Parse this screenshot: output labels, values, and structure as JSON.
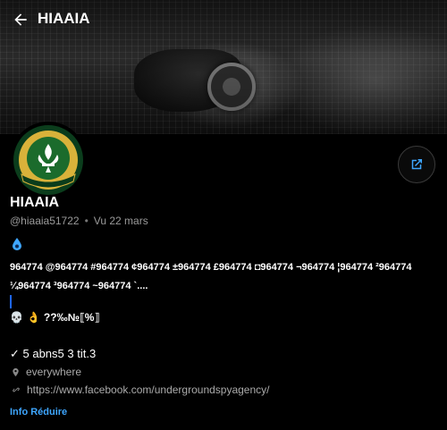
{
  "header": {
    "title": "HIAAIA",
    "back_icon": "arrow-left-icon"
  },
  "banner": {
    "description_icon": "banner-image"
  },
  "avatar": {
    "text": "TOUJOURS PRET"
  },
  "share": {
    "icon": "share-icon"
  },
  "profile": {
    "name": "HIAAIA",
    "handle": "@hiaaia51722",
    "separator": "•",
    "seen": "Vu  22 mars"
  },
  "bio": {
    "icon": "drop-icon",
    "text": "964774 @964774 #964774 ¢964774 ±964774 £964774 ◘964774 ¬964774 ¦964774 ²964774 ¼964774 ³964774 ~964774 `....",
    "emoji_line": "??‰№⟦%⟧"
  },
  "stats": {
    "line": "✓ 5 abns5 3 tit.3"
  },
  "location": {
    "icon": "location-pin-icon",
    "text": "everywhere"
  },
  "website": {
    "icon": "link-icon",
    "url": "https://www.facebook.com/undergroundspyagency/"
  },
  "info_toggle": {
    "label": "Info Réduire"
  },
  "colors": {
    "accent": "#3ea6ff",
    "background": "#000000",
    "muted": "#9a9a9a"
  }
}
